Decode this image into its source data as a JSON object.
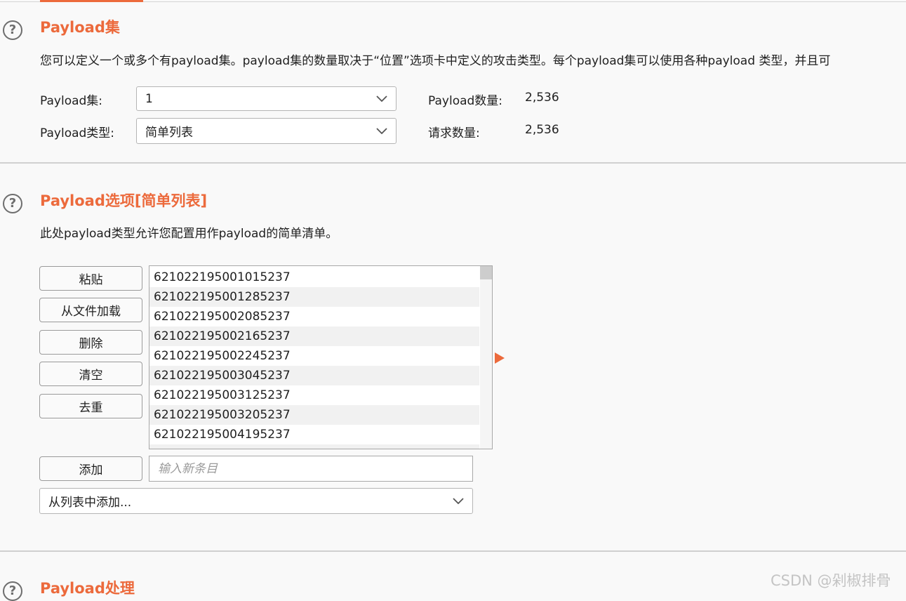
{
  "sections": {
    "payload_sets": {
      "title": "Payload集",
      "description": "您可以定义一个或多个有payload集。payload集的数量取决于“位置”选项卡中定义的攻击类型。每个payload集可以使用各种payload 类型，并且可",
      "payload_set_label": "Payload集:",
      "payload_set_value": "1",
      "payload_type_label": "Payload类型:",
      "payload_type_value": "简单列表",
      "payload_count_label": "Payload数量:",
      "payload_count_value": "2,536",
      "request_count_label": "请求数量:",
      "request_count_value": "2,536"
    },
    "payload_options": {
      "title": "Payload选项[简单列表]",
      "description": "此处payload类型允许您配置用作payload的简单清单。",
      "buttons": {
        "paste": "粘贴",
        "load": "从文件加载",
        "remove": "删除",
        "clear": "清空",
        "dedupe": "去重",
        "add": "添加"
      },
      "items": [
        "621022195001015237",
        "621022195001285237",
        "621022195002085237",
        "621022195002165237",
        "621022195002245237",
        "621022195003045237",
        "621022195003125237",
        "621022195003205237",
        "621022195004195237"
      ],
      "new_item_placeholder": "输入新条目",
      "add_from_list": "从列表中添加..."
    },
    "payload_processing": {
      "title": "Payload处理"
    }
  },
  "icons": {
    "help": "?"
  },
  "watermark": "CSDN @剁椒排骨",
  "colors": {
    "accent": "#ec6a3c"
  }
}
